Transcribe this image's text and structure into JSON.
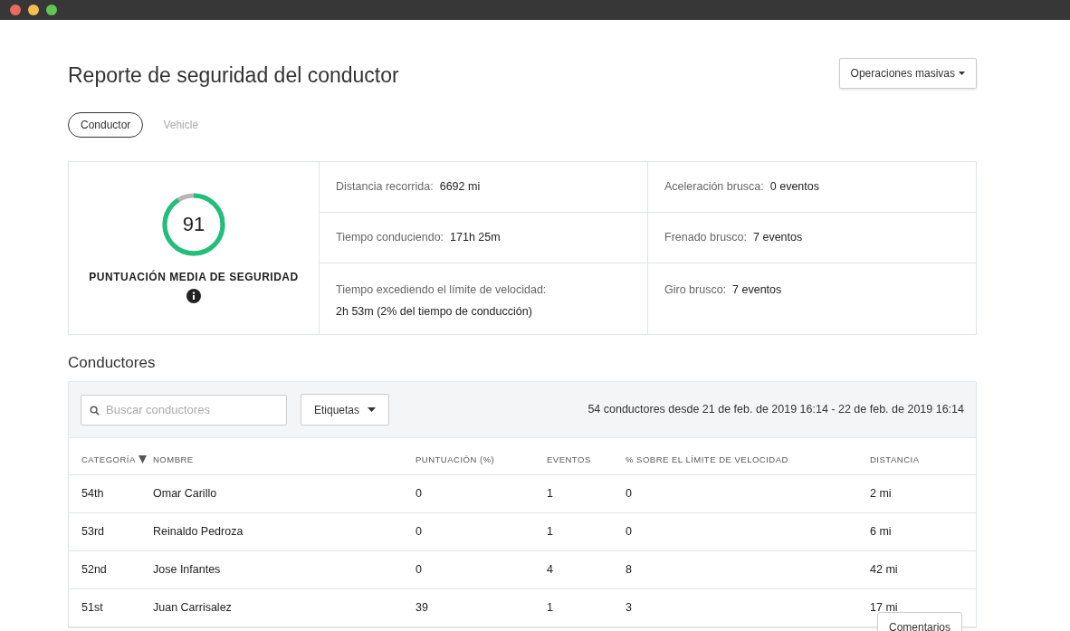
{
  "window": {
    "controls": [
      {
        "color": "#ed6a5e"
      },
      {
        "color": "#f5bf4f"
      },
      {
        "color": "#61c554"
      }
    ]
  },
  "title": "Reporte de seguridad del conductor",
  "bulk_button": {
    "label": "Operaciones masivas"
  },
  "tabs": [
    {
      "label": "Conductor",
      "selected": true
    },
    {
      "label": "Vehicle",
      "selected": false
    }
  ],
  "score": {
    "value": "91",
    "label": "PUNTUACIÓN MEDIA DE SEGURIDAD"
  },
  "stats": [
    {
      "kind": "inline",
      "label": "Distancia recorrida:",
      "value": "6692 mi"
    },
    {
      "kind": "inline",
      "label": "Aceleración brusca:",
      "value": "0 eventos"
    },
    {
      "kind": "inline",
      "label": "Tiempo conduciendo:",
      "value": "171h 25m"
    },
    {
      "kind": "inline",
      "label": "Frenado brusco:",
      "value": "7 eventos"
    },
    {
      "kind": "stacked",
      "label": "Tiempo excediendo el límite de velocidad:",
      "value": "2h 53m (2% del tiempo de conducción)"
    },
    {
      "kind": "inline",
      "label": "Giro brusco:",
      "value": "7 eventos"
    }
  ],
  "section_title": "Conductores",
  "search": {
    "placeholder": "Buscar conductores"
  },
  "tags_button": {
    "label": "Etiquetas"
  },
  "summary": "54 conductores desde 21 de feb. de 2019 16:14 - 22 de feb. de 2019 16:14",
  "table": {
    "columns": [
      {
        "label": "CATEGORÍA",
        "sorted": true
      },
      {
        "label": "NOMBRE",
        "sorted": false
      },
      {
        "label": "PUNTUACIÓN (%)",
        "sorted": false
      },
      {
        "label": "EVENTOS",
        "sorted": false
      },
      {
        "label": "% SOBRE EL LÍMITE DE VELOCIDAD",
        "sorted": false
      },
      {
        "label": "DISTANCIA",
        "sorted": false
      }
    ],
    "rows": [
      [
        "54th",
        "Omar Carillo",
        "0",
        "1",
        "0",
        "2 mi"
      ],
      [
        "53rd",
        "Reinaldo Pedroza",
        "0",
        "1",
        "0",
        "6 mi"
      ],
      [
        "52nd",
        "Jose Infantes",
        "0",
        "4",
        "8",
        "42 mi"
      ],
      [
        "51st",
        "Juan Carrisalez",
        "39",
        "1",
        "3",
        "17 mi"
      ]
    ]
  },
  "feedback_button": {
    "label": "Comentarios"
  }
}
